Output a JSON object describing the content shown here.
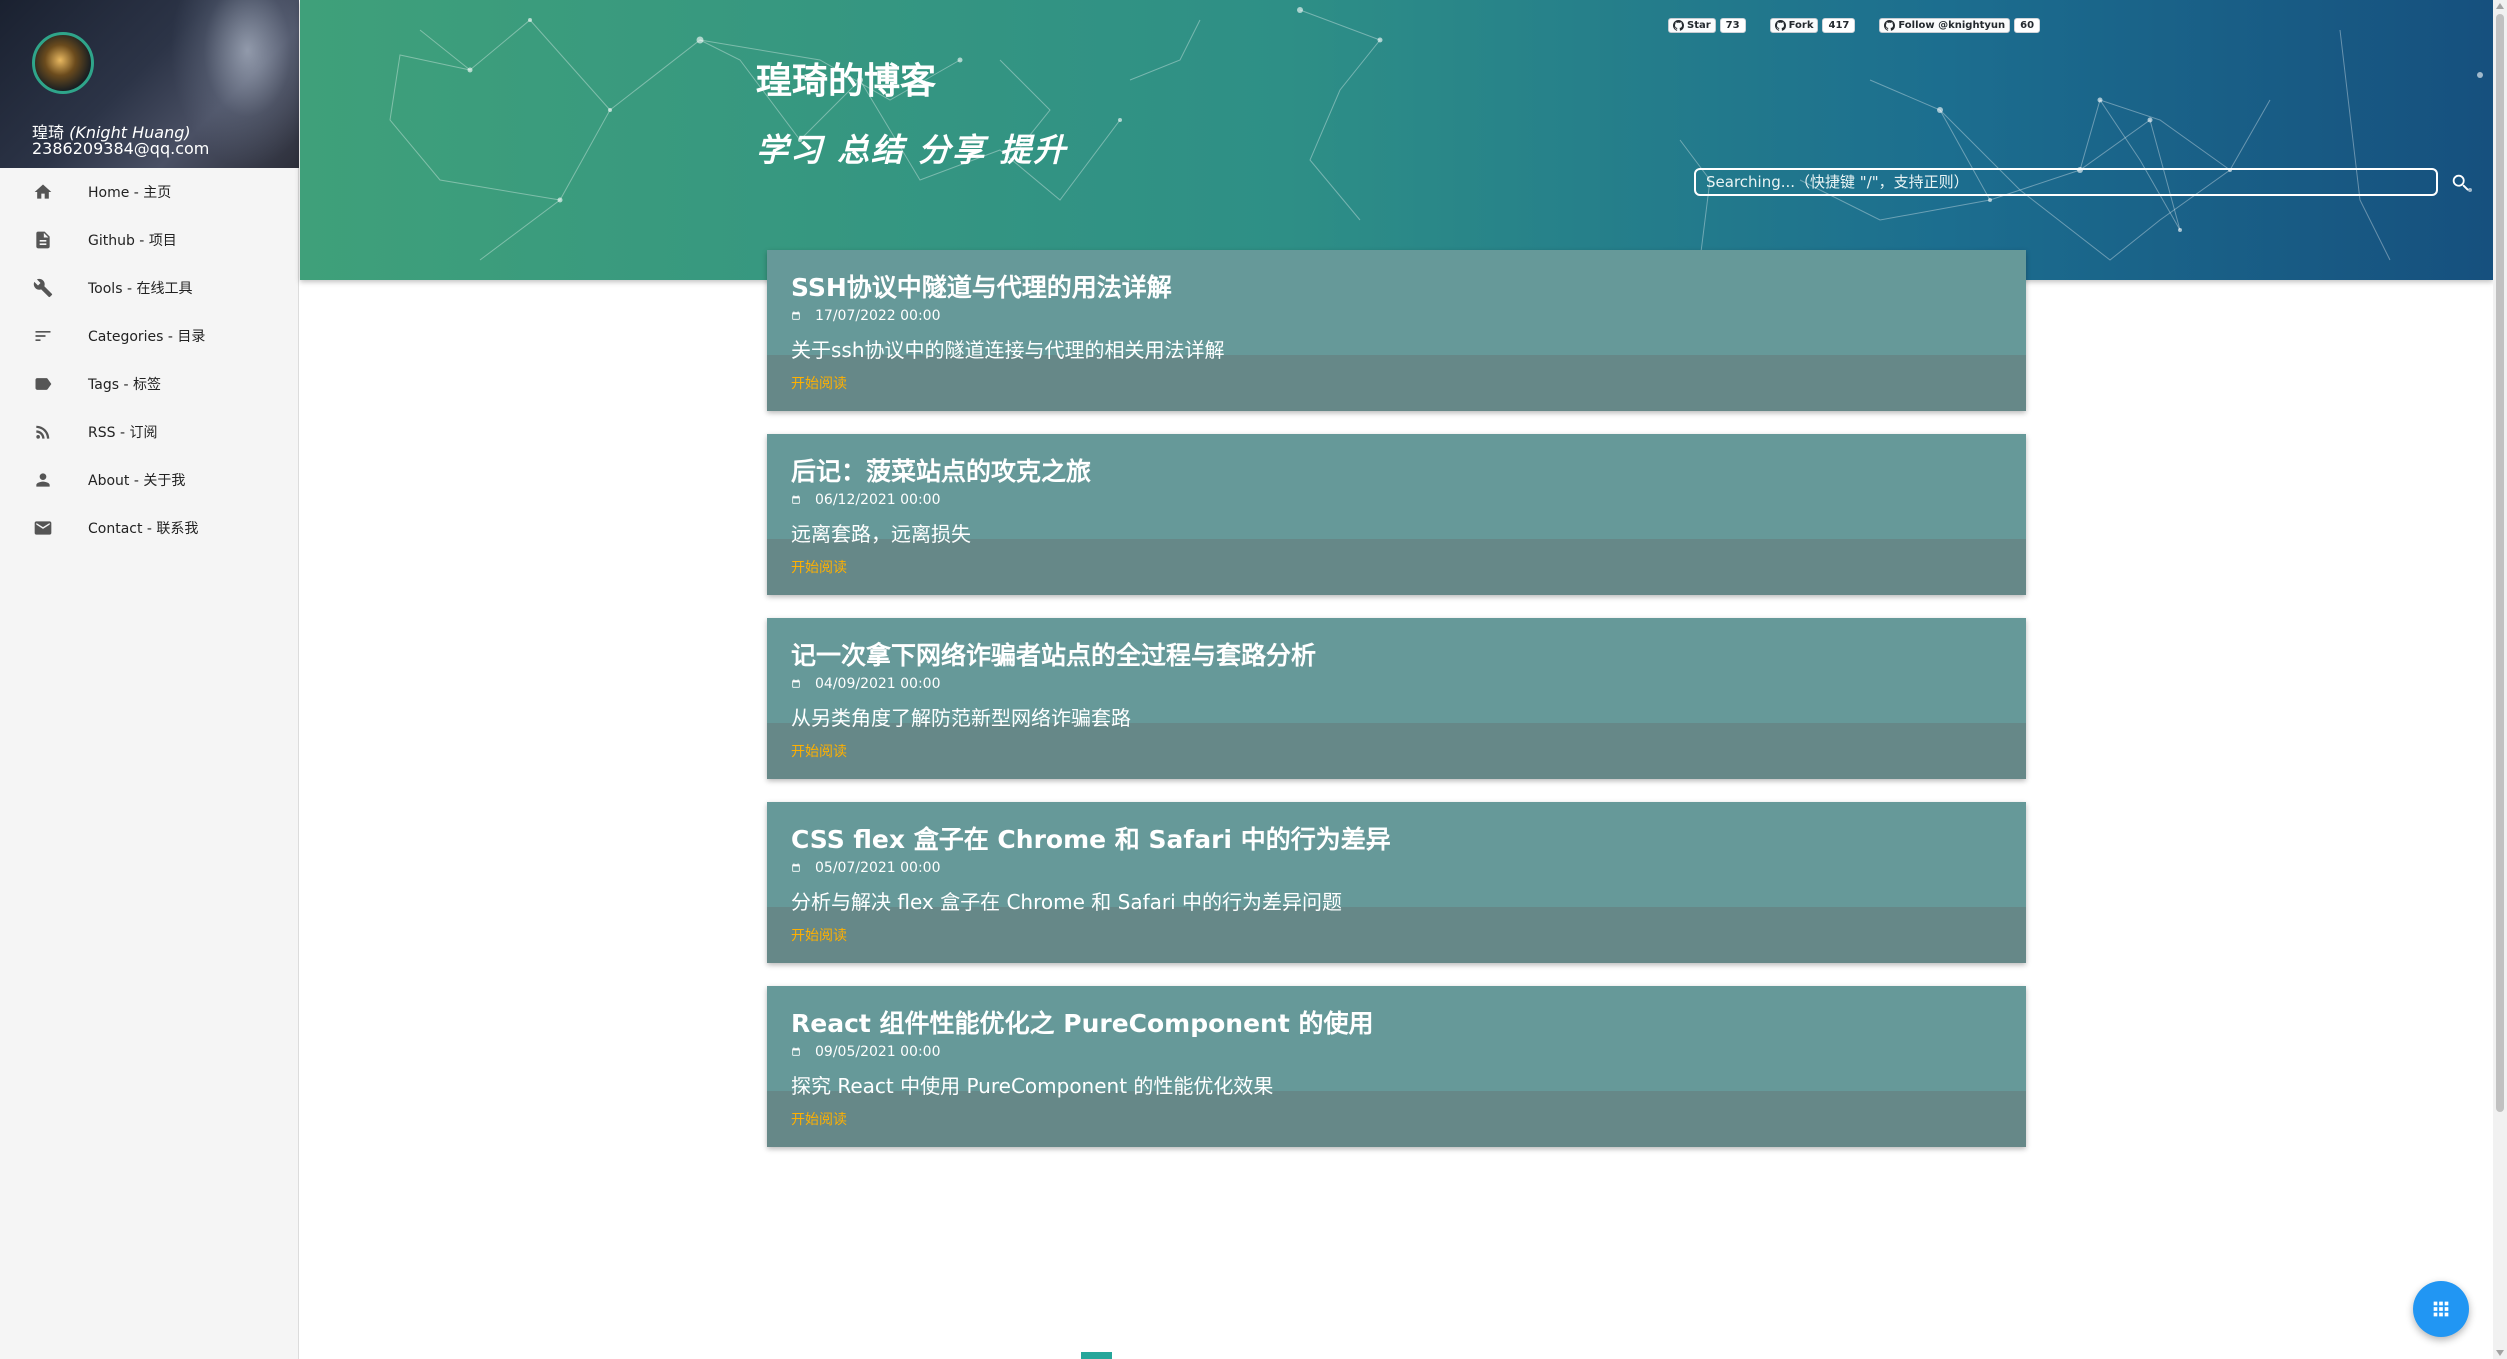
{
  "profile": {
    "name": "瑝琦",
    "name_en": "(Knight Huang)",
    "email": "2386209384@qq.com"
  },
  "sidebar": {
    "items": [
      {
        "label": "Home - 主页",
        "icon": "home-icon"
      },
      {
        "label": "Github - 项目",
        "icon": "file-icon"
      },
      {
        "label": "Tools - 在线工具",
        "icon": "wrench-icon"
      },
      {
        "label": "Categories - 目录",
        "icon": "sort-icon"
      },
      {
        "label": "Tags - 标签",
        "icon": "label-icon"
      },
      {
        "label": "RSS - 订阅",
        "icon": "rss-icon"
      },
      {
        "label": "About - 关于我",
        "icon": "person-icon"
      },
      {
        "label": "Contact - 联系我",
        "icon": "email-icon"
      }
    ]
  },
  "header": {
    "title": "瑝琦的博客",
    "motto": "学习  总结  分享  提升",
    "github": {
      "star_label": "Star",
      "star_count": "73",
      "fork_label": "Fork",
      "fork_count": "417",
      "follow_label": "Follow @knightyun",
      "follow_count": "60"
    },
    "search_placeholder": "Searching...（快捷键 \"/\"，支持正则）"
  },
  "posts": [
    {
      "title": "SSH协议中隧道与代理的用法详解",
      "date": "17/07/2022 00:00",
      "summary": "关于ssh协议中的隧道连接与代理的相关用法详解",
      "read_label": "开始阅读"
    },
    {
      "title": "后记：菠菜站点的攻克之旅",
      "date": "06/12/2021 00:00",
      "summary": "远离套路，远离损失",
      "read_label": "开始阅读"
    },
    {
      "title": "记一次拿下网络诈骗者站点的全过程与套路分析",
      "date": "04/09/2021 00:00",
      "summary": "从另类角度了解防范新型网络诈骗套路",
      "read_label": "开始阅读"
    },
    {
      "title": "CSS flex 盒子在 Chrome 和 Safari 中的行为差异",
      "date": "05/07/2021 00:00",
      "summary": "分析与解决 flex 盒子在 Chrome 和 Safari 中的行为差异问题",
      "read_label": "开始阅读"
    },
    {
      "title": "React 组件性能优化之 PureComponent 的使用",
      "date": "09/05/2021 00:00",
      "summary": "探究 React 中使用 PureComponent 的性能优化效果",
      "read_label": "开始阅读"
    }
  ],
  "colors": {
    "card_body": "#669999",
    "card_footer": "#668888",
    "read_link": "#ffb000",
    "fab": "#2196f3",
    "header_start": "#3fa07a",
    "header_end": "#16507e"
  },
  "fab_icon": "apps-grid-icon"
}
